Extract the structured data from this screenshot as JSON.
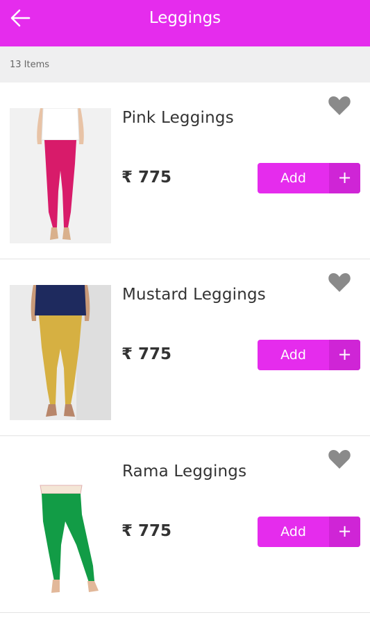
{
  "header": {
    "title": "Leggings",
    "back_icon": "arrow-left-icon"
  },
  "count_label": "13 Items",
  "colors": {
    "brand": "#e52ced",
    "brand_dark": "#cf25d6",
    "heart": "#8a8a8a"
  },
  "products": [
    {
      "name": "Pink Leggings",
      "price": "₹ 775",
      "add_label": "Add",
      "plus_label": "+"
    },
    {
      "name": "Mustard Leggings",
      "price": "₹ 775",
      "add_label": "Add",
      "plus_label": "+"
    },
    {
      "name": "Rama Leggings",
      "price": "₹ 775",
      "add_label": "Add",
      "plus_label": "+"
    }
  ]
}
